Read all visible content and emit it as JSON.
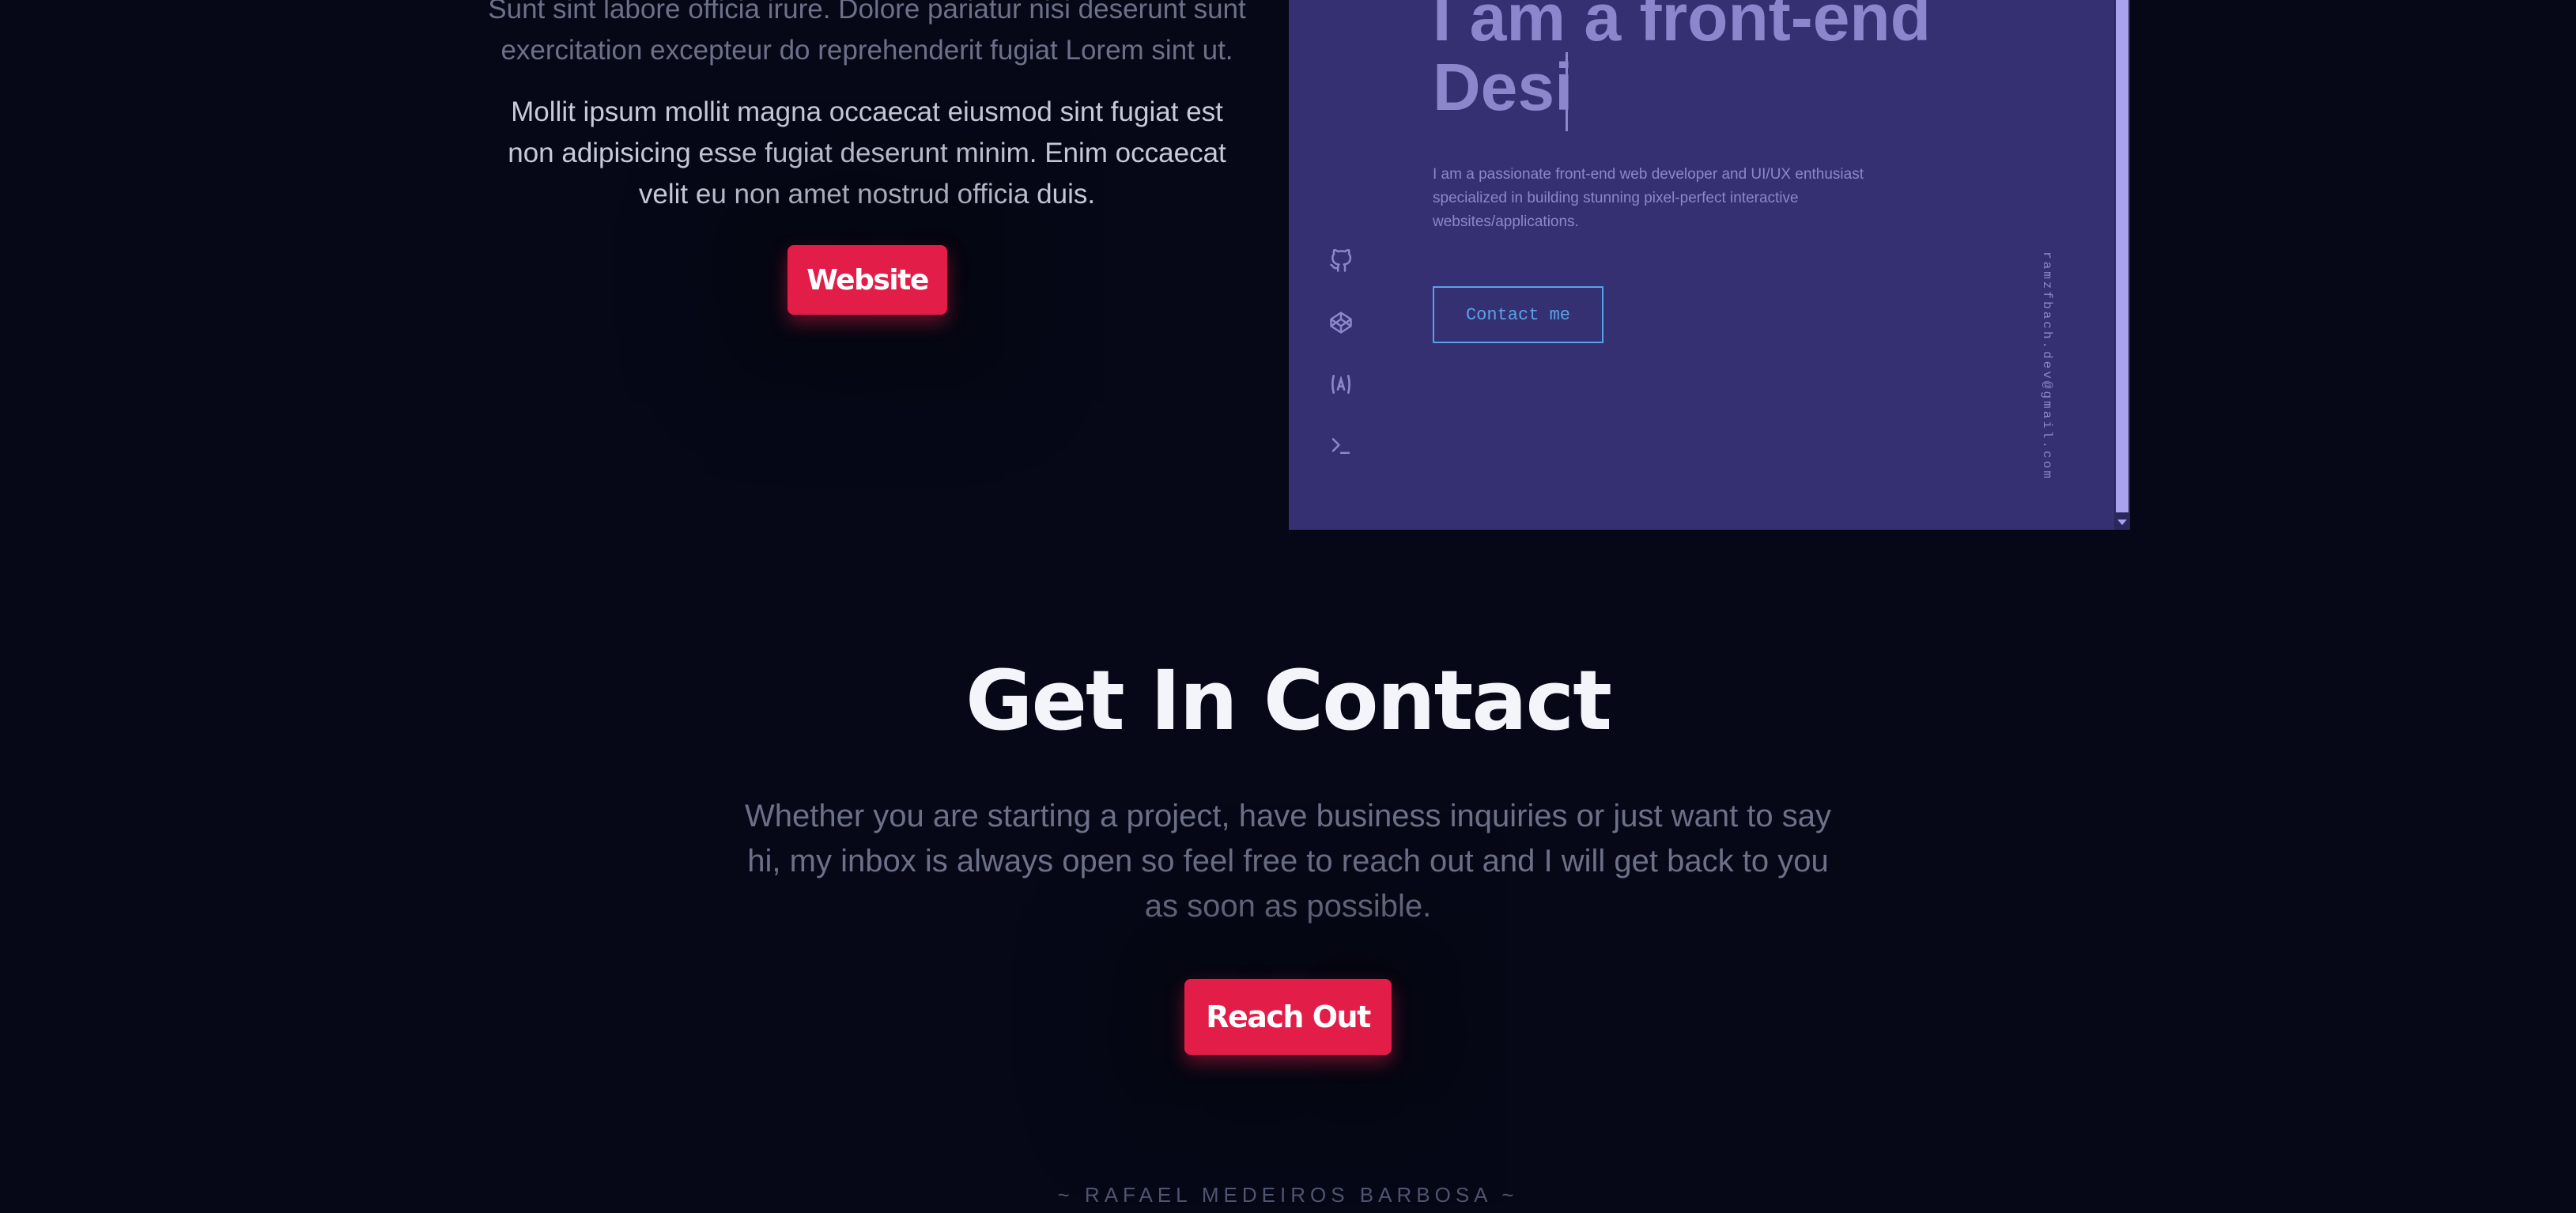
{
  "project": {
    "paragraph_faded": "Sunt sint labore officia irure. Dolore pariatur nisi deserunt sunt exercitation excepteur do reprehenderit fugiat Lorem sint ut.",
    "paragraph_main": "Mollit ipsum mollit magna occaecat eiusmod sint fugiat est non adipisicing esse fugiat deserunt minim. Enim occaecat velit eu non amet nostrud officia duis.",
    "website_label": "Website"
  },
  "preview": {
    "hero_title": "I am a front-end\nDesi",
    "hero_description": "I am a passionate front-end web developer and UI/UX enthusiast specialized in building stunning pixel-perfect interactive websites/applications.",
    "contact_label": "Contact me",
    "email": "ramzfbach.dev@gmail.com",
    "social_icons": [
      "github-icon",
      "codepen-icon",
      "angular-icon",
      "terminal-icon"
    ]
  },
  "contact": {
    "title": "Get In Contact",
    "text": "Whether you are starting a project, have business inquiries or just want to say hi, my inbox is always open so feel free to reach out and I will get back to you as soon as possible.",
    "button_label": "Reach Out"
  },
  "footer": {
    "text": "~ RAFAEL MEDEIROS BARBOSA ~"
  },
  "colors": {
    "background": "#060817",
    "accent": "#e11d48",
    "preview_bg": "#353071",
    "preview_text": "#8c86cd",
    "preview_link": "#58a3e8"
  }
}
